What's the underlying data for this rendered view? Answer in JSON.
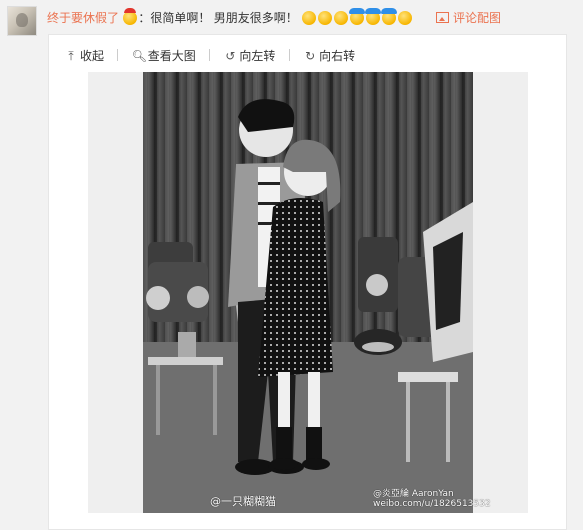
{
  "comment": {
    "username": "终于要休假了",
    "colon": "：",
    "text": "很简单啊！ 男朋友很多啊！",
    "emojis": [
      "surprised-fox-emoji",
      "surprised-emoji",
      "surprised-emoji",
      "surprised-emoji",
      "blue-hat-emoji",
      "blue-hat-emoji",
      "blue-hat-emoji",
      "smile-emoji"
    ],
    "action_label": "评论配图"
  },
  "toolbar": {
    "collapse": "收起",
    "view_large": "查看大图",
    "rotate_left": "向左转",
    "rotate_right": "向右转"
  },
  "photo": {
    "watermark_left": "@一只糊糊猫",
    "watermark_right_name": "@炎亞綸 AaronYan",
    "watermark_right_url": "weibo.com/u/1826513532"
  },
  "colors": {
    "accent": "#eb7350",
    "card_bg": "#ffffff",
    "page_bg": "#f2f2f2"
  }
}
